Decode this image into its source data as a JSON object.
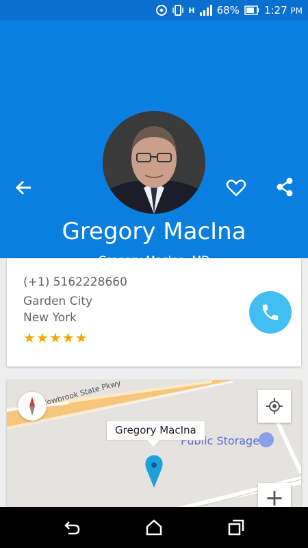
{
  "status_bar": {
    "battery": "68%",
    "time": "1:27",
    "ampm": "PM",
    "network": "H"
  },
  "header": {
    "name": "Gregory MacIna",
    "subtitle": "Gregory MacIna, MD",
    "bg_color": "#0a7fe0"
  },
  "contact": {
    "phone": "(+1) 5162228660",
    "city": "Garden City",
    "state": "New York",
    "rating_stars": "★★★★★",
    "rating": 5,
    "call_color": "#41bff2"
  },
  "map": {
    "road_name": "Meadowbrook State Pkwy",
    "marker_title": "Gregory MacIna",
    "poi_name": "Public Storage",
    "zoom_in_label": "+"
  },
  "icons": {
    "back": "arrow-back-icon",
    "favorite": "heart-icon",
    "share": "share-icon",
    "call": "phone-icon",
    "compass": "compass-icon",
    "locate": "my-location-icon",
    "pin": "map-pin-icon"
  }
}
